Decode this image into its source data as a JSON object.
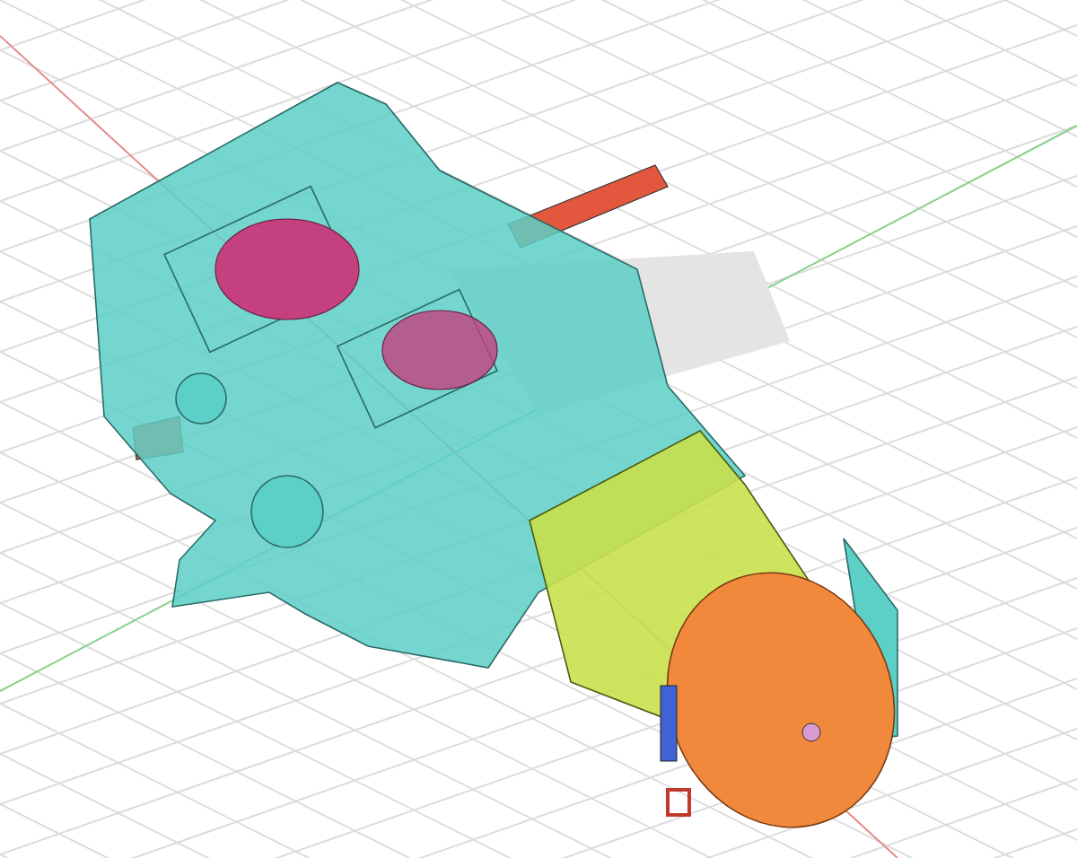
{
  "parts": [
    {
      "kind": "shaft",
      "color": "#e2573d"
    },
    {
      "kind": "housing",
      "color": "#5ccfc6"
    },
    {
      "kind": "gear",
      "color": "#c4407e"
    },
    {
      "kind": "motor",
      "color": "#c9e04c"
    },
    {
      "kind": "endcap",
      "color": "#f0893c"
    },
    {
      "kind": "terminal",
      "color": "#3f63d4"
    }
  ]
}
